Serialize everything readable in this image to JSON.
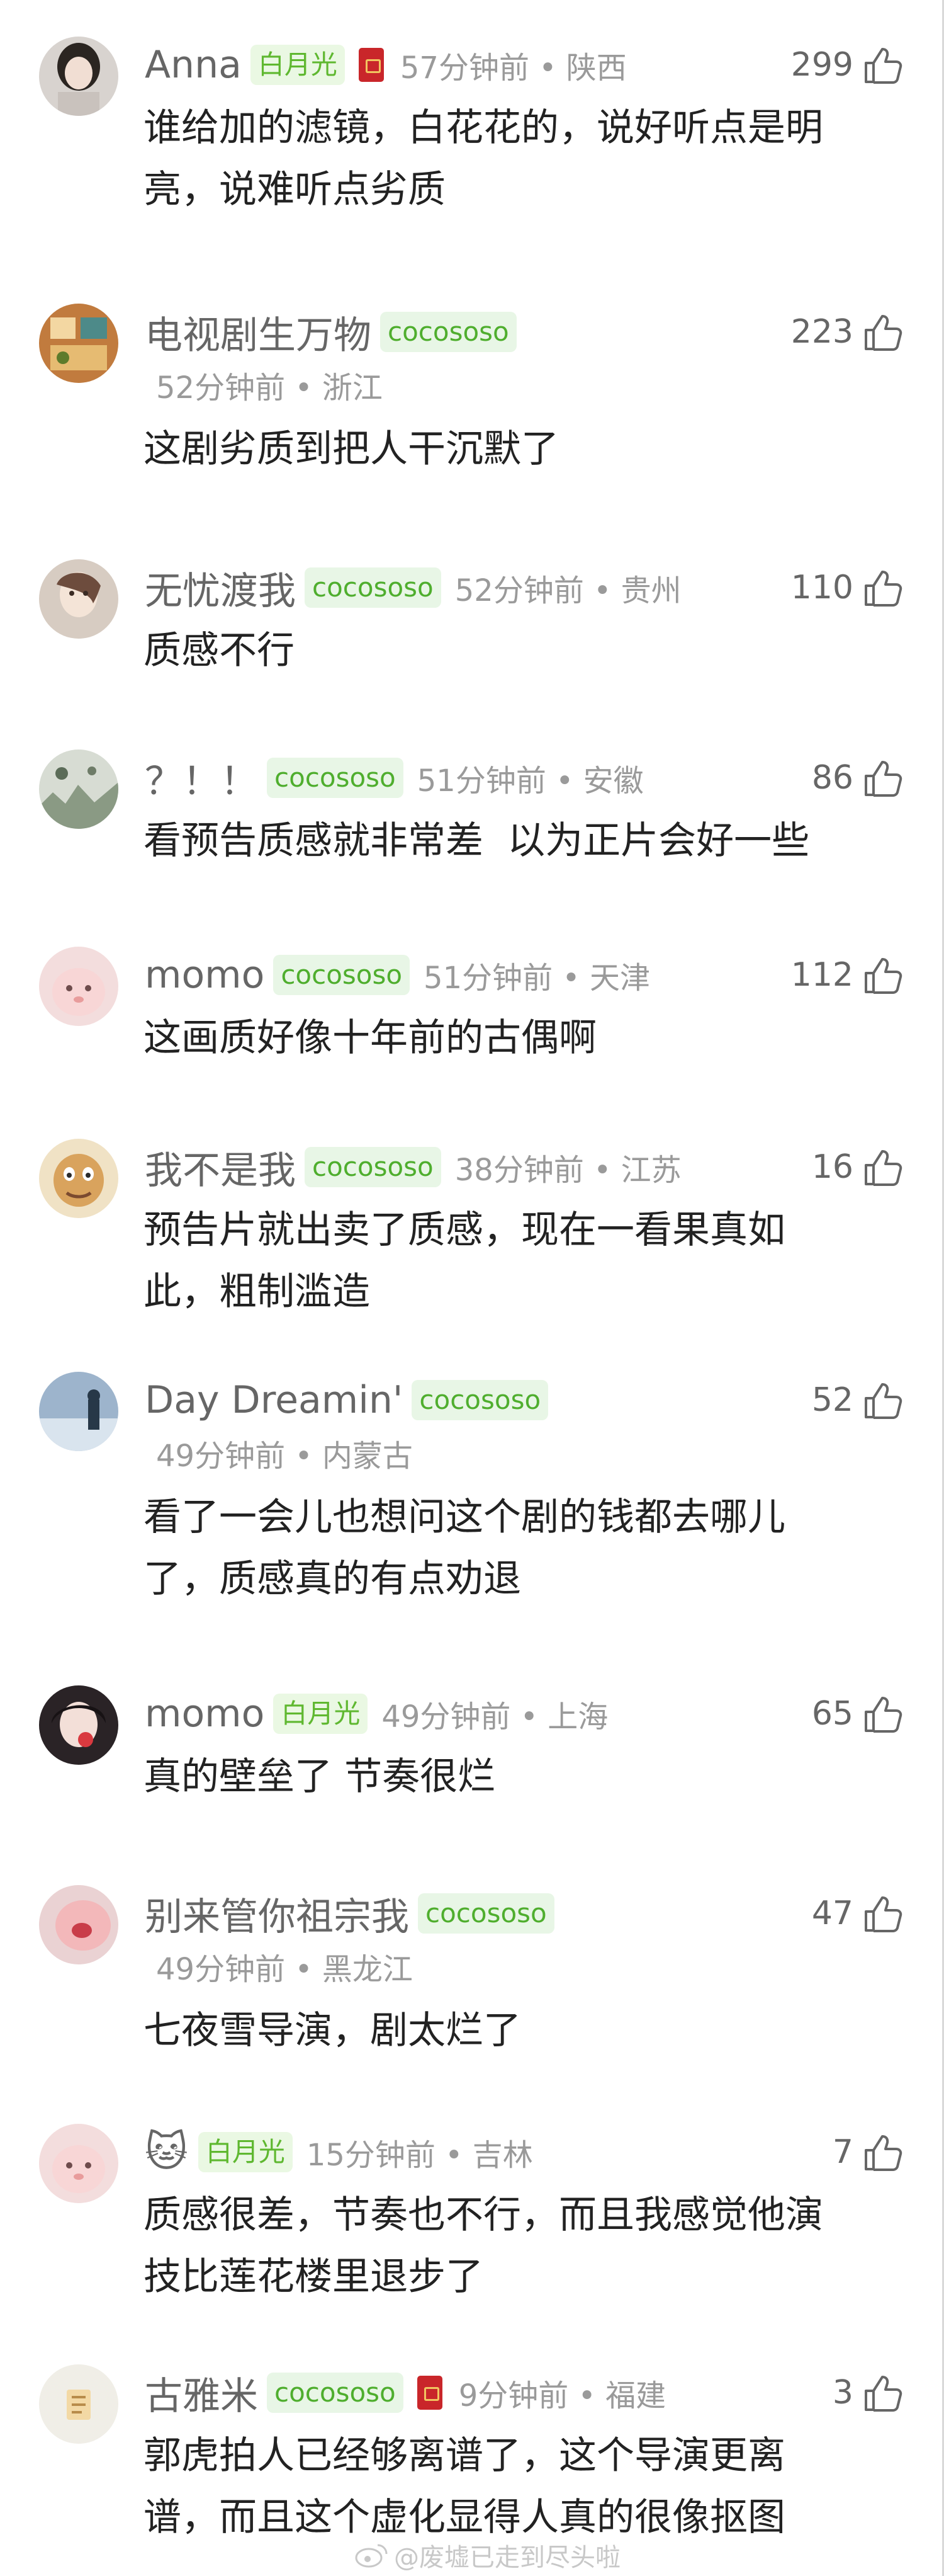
{
  "comments": [
    {
      "username": "Anna",
      "badge": "白月光",
      "has_redpacket": true,
      "time_location": "57分钟前 • 陕西",
      "likes": "299",
      "text": "谁给加的滤镜，白花花的，说好听点是明\n亮，说难听点劣质"
    },
    {
      "username": "电视剧生万物",
      "badge": "cocososo",
      "time_location": "52分钟前 • 浙江",
      "likes": "223",
      "text": "这剧劣质到把人干沉默了"
    },
    {
      "username": "无忧渡我",
      "badge": "cocososo",
      "time_location": "52分钟前 • 贵州",
      "likes": "110",
      "text": "质感不行"
    },
    {
      "username": "？！！",
      "badge": "cocososo",
      "time_location": "51分钟前 • 安徽",
      "likes": "86",
      "text": "看预告质感就非常差  以为正片会好一些"
    },
    {
      "username": "momo",
      "badge": "cocososo",
      "time_location": "51分钟前 • 天津",
      "likes": "112",
      "text": "这画质好像十年前的古偶啊"
    },
    {
      "username": "我不是我",
      "badge": "cocososo",
      "time_location": "38分钟前 • 江苏",
      "likes": "16",
      "text": "预告片就出卖了质感，现在一看果真如\n此，粗制滥造"
    },
    {
      "username": "Day Dreamin'",
      "badge": "cocososo",
      "time_location": "49分钟前 • 内蒙古",
      "likes": "52",
      "text": "看了一会儿也想问这个剧的钱都去哪儿\n了，质感真的有点劝退"
    },
    {
      "username": "momo",
      "badge": "白月光",
      "time_location": "49分钟前 • 上海",
      "likes": "65",
      "text": "真的壁垒了 节奏很烂"
    },
    {
      "username": "别来管你祖宗我",
      "badge": "cocososo",
      "time_location": "49分钟前 • 黑龙江",
      "likes": "47",
      "text": "七夜雪导演，剧太烂了"
    },
    {
      "username": "🐱",
      "badge": "白月光",
      "time_location": "15分钟前 • 吉林",
      "likes": "7",
      "text": "质感很差，节奏也不行，而且我感觉他演\n技比莲花楼里退步了"
    },
    {
      "username": "古雅米",
      "badge": "cocososo",
      "has_redpacket": true,
      "time_location": "9分钟前 • 福建",
      "likes": "3",
      "text": "郭虎拍人已经够离谱了，这个导演更离\n谱，而且这个虚化显得人真的很像抠图"
    }
  ],
  "watermark": "@废墟已走到尽头啦",
  "colors": {
    "badge_text": "#5fb830",
    "badge_bg": "#eaf8e3",
    "username": "#666666",
    "meta": "#9a9a9a",
    "body_text": "#222222"
  }
}
